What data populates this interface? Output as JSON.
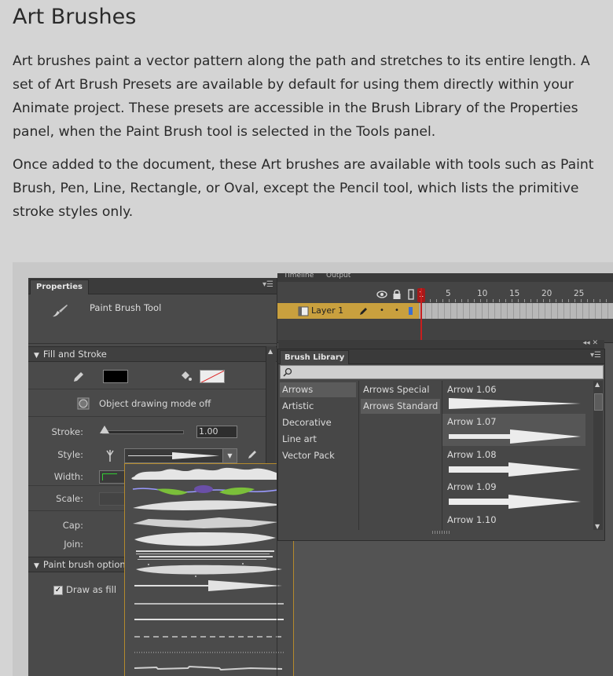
{
  "article": {
    "title": "Art Brushes",
    "para1": "Art brushes paint a vector pattern along the path and stretches to its entire length. A set of Art Brush Presets are available by default for using them directly within your Animate project. These presets are accessible in the Brush Library of the Properties panel, when the Paint Brush tool is selected in the Tools panel.",
    "para2": "Once added to the document, these Art brushes are available with tools such as Paint Brush, Pen, Line, Rectangle, or Oval, except the Pencil tool, which lists the primitive stroke styles only."
  },
  "properties": {
    "tab": "Properties",
    "tool_name": "Paint Brush Tool",
    "fill_stroke_header": "Fill and Stroke",
    "fill_color": "#000000",
    "object_drawing": "Object drawing mode off",
    "stroke_label": "Stroke:",
    "stroke_value": "1.00",
    "style_label": "Style:",
    "width_label": "Width:",
    "scale_label": "Scale:",
    "cap_label": "Cap:",
    "join_label": "Join:",
    "brush_options_header": "Paint brush option",
    "draw_as_fill": "Draw as fill",
    "draw_as_fill_checked": true
  },
  "timeline": {
    "tabs": [
      "Timeline",
      "Output"
    ],
    "frame_numbers": [
      "1",
      "5",
      "10",
      "15",
      "20",
      "25"
    ],
    "current_frame": "1",
    "layer_name": "Layer 1"
  },
  "brush_library": {
    "title": "Brush Library",
    "categories": [
      "Arrows",
      "Artistic",
      "Decorative",
      "Line art",
      "Vector Pack"
    ],
    "selected_category": "Arrows",
    "subcategories": [
      "Arrows Special",
      "Arrows Standard"
    ],
    "selected_subcategory": "Arrows Standard",
    "presets": [
      "Arrow 1.06",
      "Arrow 1.07",
      "Arrow 1.08",
      "Arrow 1.09",
      "Arrow 1.10"
    ],
    "selected_preset": "Arrow 1.07"
  },
  "colors": {
    "page_bg": "#d4d4d4",
    "panel_bg": "#4a4a4a",
    "layer_highlight": "#c9a03e",
    "playhead": "#c81e1e",
    "popup_border": "#b48a2c"
  }
}
